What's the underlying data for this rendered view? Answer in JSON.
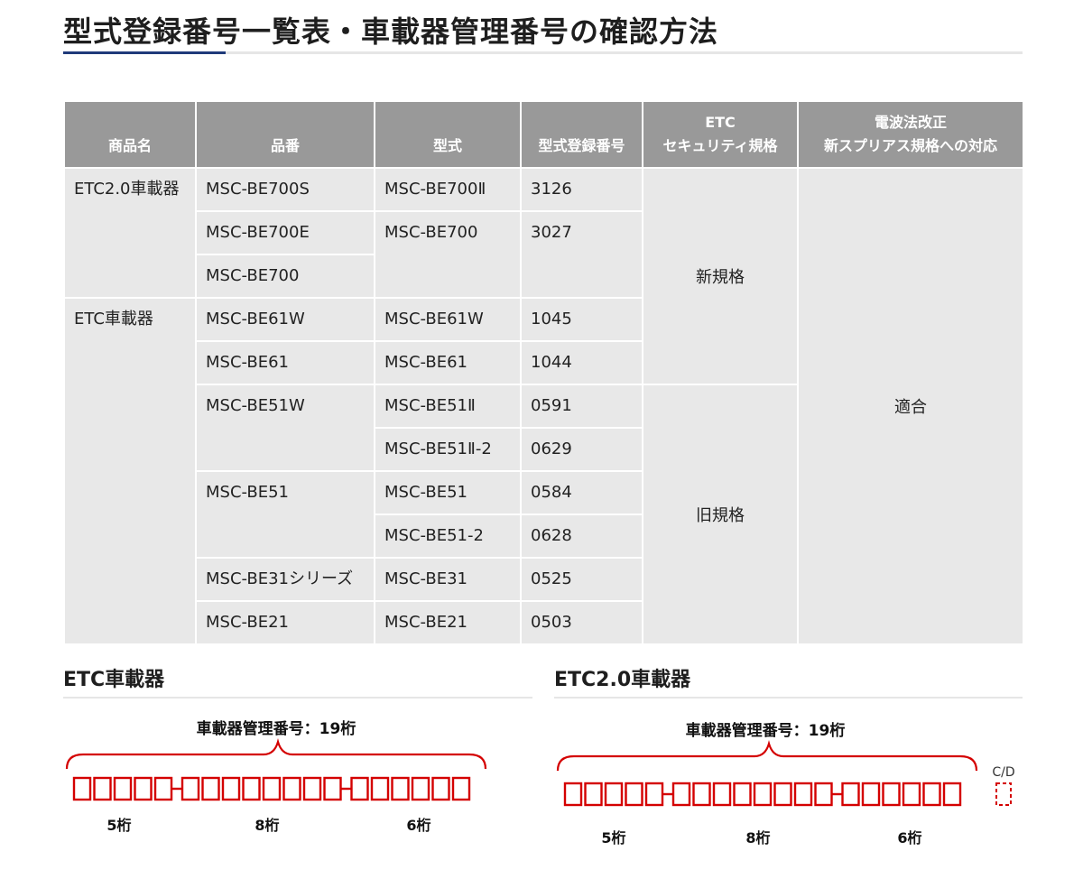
{
  "page": {
    "title": "型式登録番号一覧表・車載器管理番号の確認方法"
  },
  "table": {
    "headers": [
      {
        "l1": "",
        "l2": "商品名"
      },
      {
        "l1": "",
        "l2": "品番"
      },
      {
        "l1": "",
        "l2": "型式"
      },
      {
        "l1": "",
        "l2": "型式登録番号"
      },
      {
        "l1": "ETC",
        "l2": "セキュリティ規格"
      },
      {
        "l1": "電波法改正",
        "l2": "新スプリアス規格への対応"
      }
    ],
    "products": [
      "ETC2.0車載器",
      "ETC車載器"
    ],
    "part_numbers": [
      "MSC-BE700S",
      "MSC-BE700E",
      "MSC-BE700",
      "MSC-BE61W",
      "MSC-BE61",
      "MSC-BE51W",
      "MSC-BE51",
      "MSC-BE31シリーズ",
      "MSC-BE21"
    ],
    "models": [
      "MSC-BE700Ⅱ",
      "MSC-BE700",
      "MSC-BE61W",
      "MSC-BE61",
      "MSC-BE51Ⅱ",
      "MSC-BE51Ⅱ-2",
      "MSC-BE51",
      "MSC-BE51-2",
      "MSC-BE31",
      "MSC-BE21"
    ],
    "reg_numbers": [
      "3126",
      "3027",
      "1045",
      "1044",
      "0591",
      "0629",
      "0584",
      "0628",
      "0525",
      "0503"
    ],
    "security": [
      "新規格",
      "旧規格"
    ],
    "spurious": "適合"
  },
  "etc": {
    "heading": "ETC車載器",
    "label": "車載器管理番号：19桁",
    "groups": [
      "5桁",
      "8桁",
      "6桁"
    ]
  },
  "etc2": {
    "heading": "ETC2.0車載器",
    "label": "車載器管理番号：19桁",
    "groups": [
      "5桁",
      "8桁",
      "6桁"
    ],
    "cd_label": "C/D"
  },
  "colors": {
    "header_bg": "#999999",
    "cell_bg": "#e8e8e8",
    "accent": "#1f3a7a",
    "diagram_red": "#d40000"
  }
}
